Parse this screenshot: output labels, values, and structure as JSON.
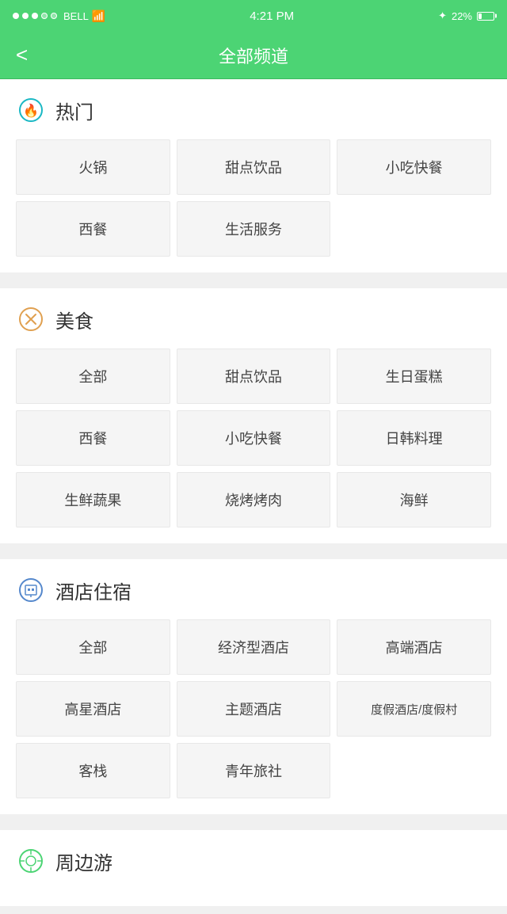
{
  "statusBar": {
    "carrier": "BELL",
    "time": "4:21 PM",
    "battery": "22%",
    "bluetooth": "✦"
  },
  "navBar": {
    "back": "<",
    "title": "全部频道"
  },
  "sections": [
    {
      "id": "hot",
      "title": "热门",
      "iconType": "hot",
      "items": [
        [
          "火锅",
          "甜点饮品",
          "小吃快餐"
        ],
        [
          "西餐",
          "生活服务"
        ]
      ]
    },
    {
      "id": "food",
      "title": "美食",
      "iconType": "food",
      "items": [
        [
          "全部",
          "甜点饮品",
          "生日蛋糕"
        ],
        [
          "西餐",
          "小吃快餐",
          "日韩料理"
        ],
        [
          "生鲜蔬果",
          "烧烤烤肉",
          "海鲜"
        ]
      ]
    },
    {
      "id": "hotel",
      "title": "酒店住宿",
      "iconType": "hotel",
      "items": [
        [
          "全部",
          "经济型酒店",
          "高端酒店"
        ],
        [
          "高星酒店",
          "主题酒店",
          "度假酒店/度假村"
        ],
        [
          "客栈",
          "青年旅社",
          ""
        ]
      ]
    },
    {
      "id": "travel",
      "title": "周边游",
      "iconType": "travel",
      "items": []
    }
  ]
}
